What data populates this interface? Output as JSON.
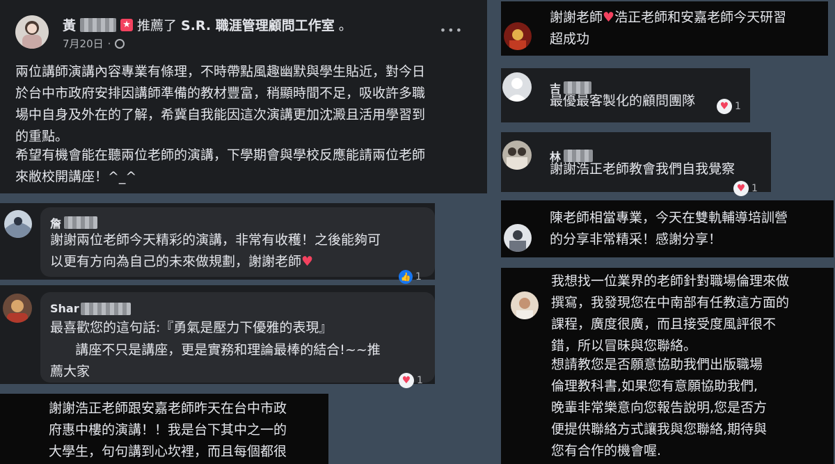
{
  "post": {
    "author_suffix": "推薦了",
    "page_name": "S.R. 職涯管理顧問工作室",
    "date": "7月20日",
    "dot": "·",
    "more": "•••",
    "para1": "兩位講師演講內容專業有條理，不時帶點風趣幽默與學生貼近，對今日\n於台中市政府安排因講師準備的教材豐富，稍顯時間不足，吸收許多職\n場中自身及外在的了解，希冀自我能因這次演講更加沈澱且活用學習到\n的重點。",
    "para2": "希望有機會能在聽兩位老師的演講，下學期會與學校反應能請兩位老師\n來敝校開講座！^_^"
  },
  "left_comments": [
    {
      "name": "詹",
      "text": "謝謝兩位老師今天精彩的演講，非常有收穫！之後能夠可\n以更有方向為自己的未來做規劃，謝謝老師",
      "heart": "♥",
      "reaction_count": "1"
    },
    {
      "name": "Shar",
      "line1": "最喜歡您的這句話:『勇氣是壓力下優雅的表現』",
      "line2": "      講座不只是講座，更是實務和理論最棒的結合!~~推\n薦大家",
      "reaction_count": "1"
    }
  ],
  "bottom_left": {
    "text": "謝謝浩正老師跟安嘉老師昨天在台中市政\n府惠中樓的演講！！我是台下其中之一的\n大學生，句句講到心坎裡，而且每個都很"
  },
  "right_comments": [
    {
      "text_a": "謝謝老師",
      "heart": "♥",
      "text_b": "浩正老師和安嘉老師今天研習\n超成功"
    },
    {
      "name": "吉",
      "text": "最優最客製化的顧問團隊",
      "reaction_count": "1"
    },
    {
      "name": "林",
      "text": "謝謝浩正老師教會我們自我覺察",
      "reaction_count": "1"
    },
    {
      "text": "陳老師相當專業，今天在雙軌輔導培訓營\n的分享非常精采！感謝分享！"
    },
    {
      "para1": "我想找一位業界的老師針對職場倫理來做\n撰寫，我發現您在中南部有任教這方面的\n課程，廣度很廣，而且接受度風評很不\n錯，所以冒昧與您聯絡。",
      "para2": "想請教您是否願意協助我們出版職場\n倫理教科書,如果您有意願協助我們,\n晚輩非常樂意向您報告說明,您是否方\n便提供聯絡方式讓我與您聯絡,期待與\n您有合作的機會喔."
    }
  ]
}
